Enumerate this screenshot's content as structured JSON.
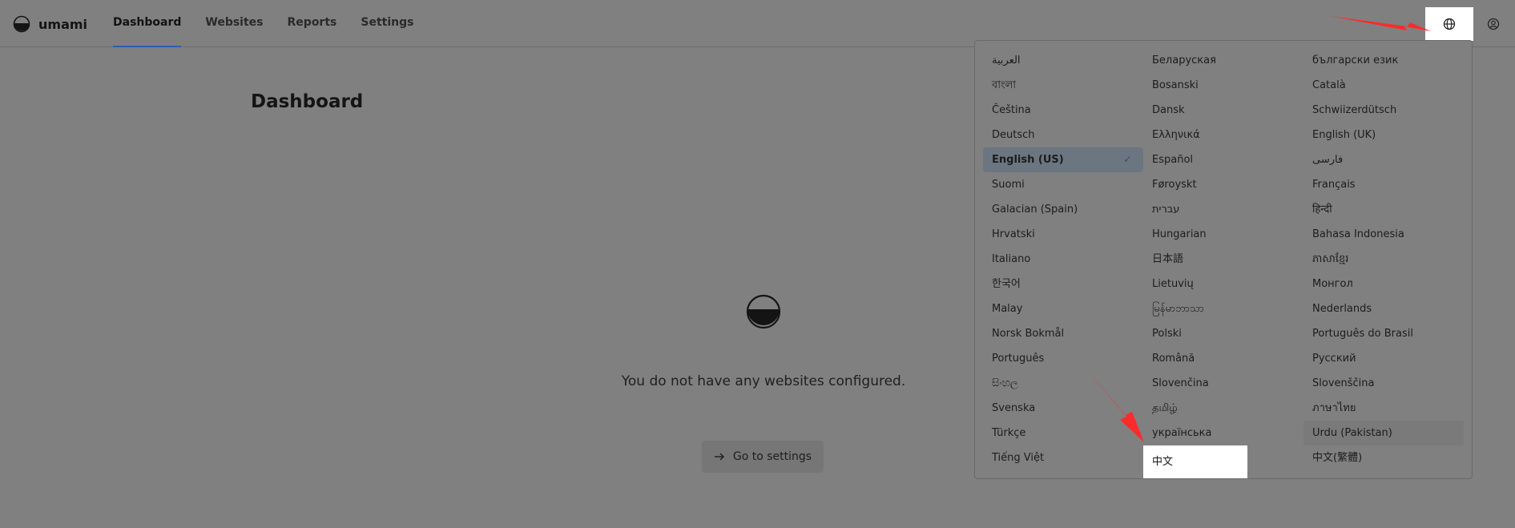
{
  "app": {
    "name": "umami"
  },
  "nav": {
    "items": [
      "Dashboard",
      "Websites",
      "Reports",
      "Settings"
    ],
    "active": "Dashboard"
  },
  "header": {
    "language_icon": "globe-icon",
    "profile_icon": "user-circle-icon"
  },
  "main": {
    "title": "Dashboard",
    "empty_message": "You do not have any websites configured.",
    "settings_button": "Go to settings",
    "settings_icon": "arrow-right-icon"
  },
  "language_menu": {
    "selected": "English (US)",
    "highlighted": "中文",
    "hovered": "Urdu (Pakistan)",
    "languages": [
      "العربية",
      "Беларуская",
      "български език",
      "বাংলা",
      "Bosanski",
      "Català",
      "Čeština",
      "Dansk",
      "Schwiizerdütsch",
      "Deutsch",
      "Ελληνικά",
      "English (UK)",
      "English (US)",
      "Español",
      "فارسی",
      "Suomi",
      "Føroyskt",
      "Français",
      "Galacian (Spain)",
      "עברית",
      "हिन्दी",
      "Hrvatski",
      "Hungarian",
      "Bahasa Indonesia",
      "Italiano",
      "日本語",
      "ភាសាខ្មែរ",
      "한국어",
      "Lietuvių",
      "Монгол",
      "Malay",
      "မြန်မာဘာသာ",
      "Nederlands",
      "Norsk Bokmål",
      "Polski",
      "Português do Brasil",
      "Português",
      "Română",
      "Русский",
      "සිංහල",
      "Slovenčina",
      "Slovenščina",
      "Svenska",
      "தமிழ்",
      "ภาษาไทย",
      "Türkçe",
      "українська",
      "Urdu (Pakistan)",
      "Tiếng Việt",
      "中文",
      "中文(繁體)"
    ]
  },
  "colors": {
    "overlay": "#808080",
    "accent": "#2a5fb0",
    "annotation_arrow": "#ff2b2b"
  }
}
